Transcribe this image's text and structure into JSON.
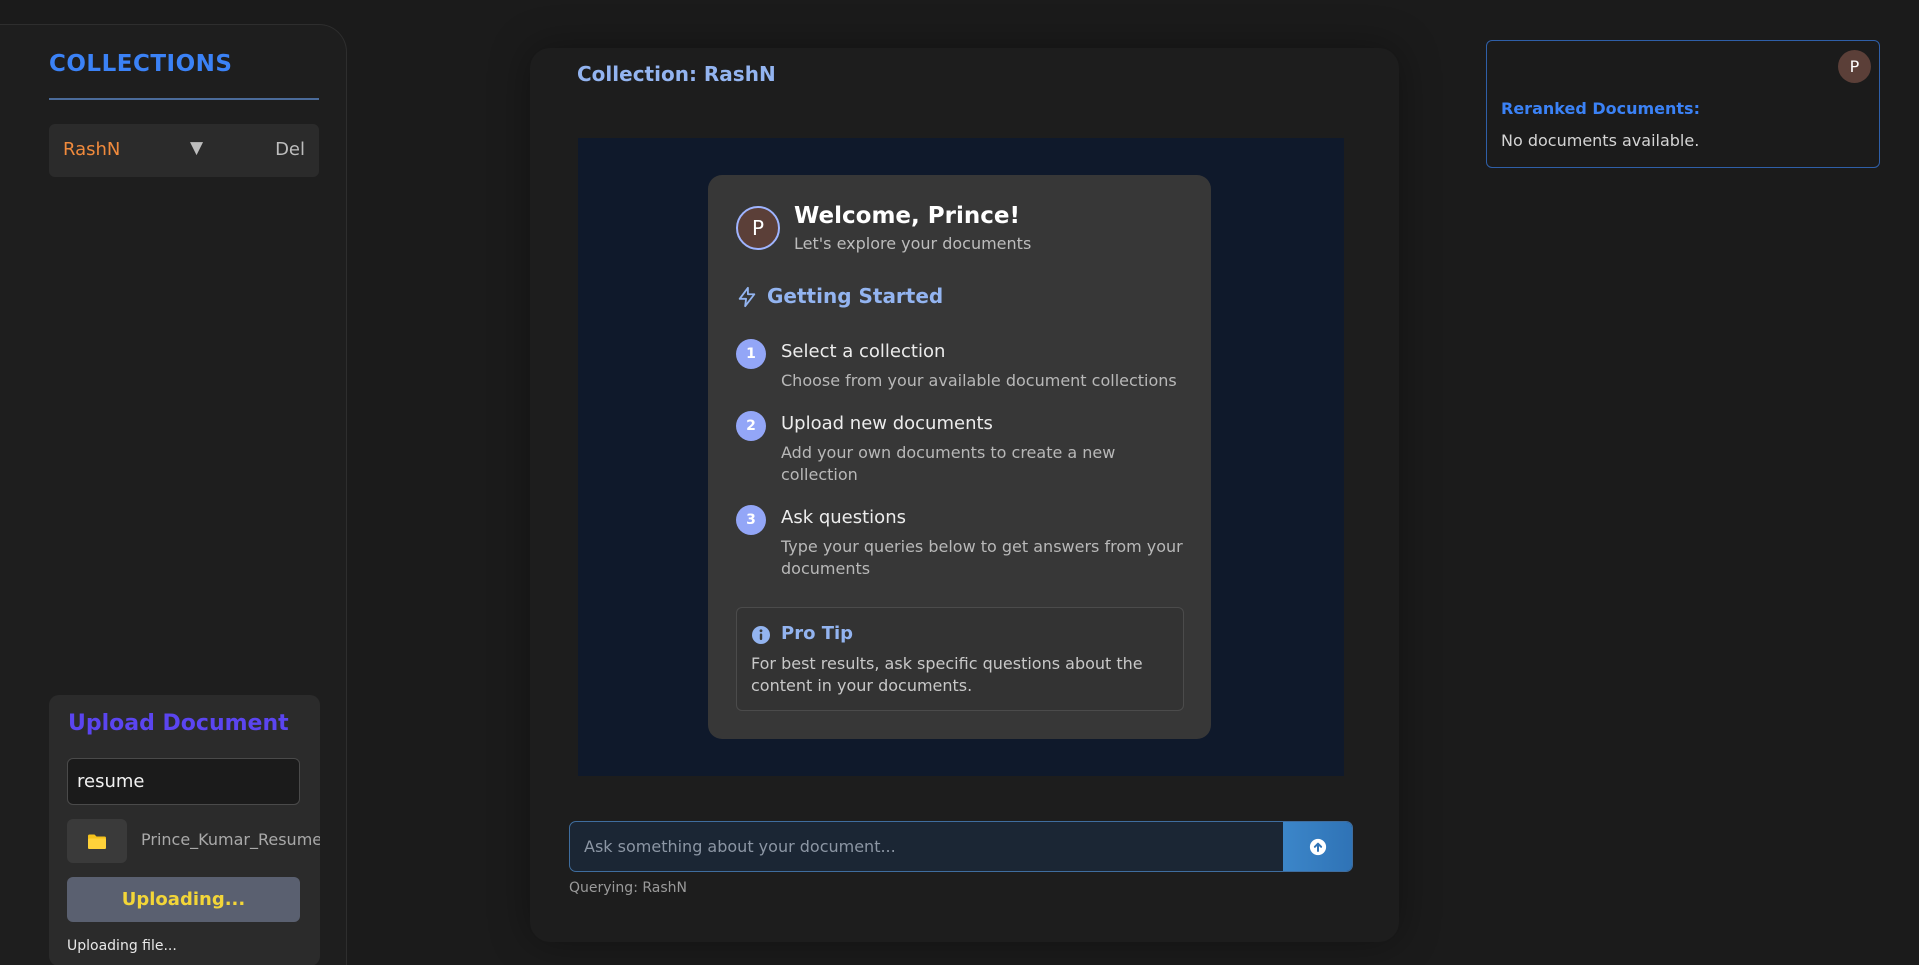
{
  "sidebar": {
    "title": "COLLECTIONS",
    "collections": [
      {
        "name": "RashN",
        "caret": "▼",
        "delete_label": "Del"
      }
    ]
  },
  "upload": {
    "title": "Upload Document",
    "input_value": "resume",
    "folder_icon": "folder-icon",
    "file_name": "Prince_Kumar_Resume.pdf",
    "button_label": "Uploading...",
    "status": "Uploading file..."
  },
  "main": {
    "title": "Collection: RashN",
    "welcome": {
      "avatar_letter": "P",
      "heading": "Welcome, Prince!",
      "subheading": "Let's explore your documents",
      "section_title": "Getting Started",
      "steps": [
        {
          "num": "1",
          "title": "Select a collection",
          "desc": "Choose from your available document collections"
        },
        {
          "num": "2",
          "title": "Upload new documents",
          "desc": "Add your own documents to create a new collection"
        },
        {
          "num": "3",
          "title": "Ask questions",
          "desc": "Type your queries below to get answers from your documents"
        }
      ],
      "tip": {
        "title": "Pro Tip",
        "text": "For best results, ask specific questions about the content in your documents."
      }
    },
    "query": {
      "placeholder": "Ask something about your document...",
      "value": "",
      "status": "Querying: RashN"
    }
  },
  "rerank": {
    "avatar_letter": "P",
    "title": "Reranked Documents:",
    "empty_text": "No documents available."
  },
  "colors": {
    "accent_blue": "#3b82f6",
    "collection_orange": "#f08a3c",
    "upload_title_purple": "#5b45f0",
    "uploading_yellow": "#f3d638",
    "heading_light_blue": "#93b4f0"
  }
}
